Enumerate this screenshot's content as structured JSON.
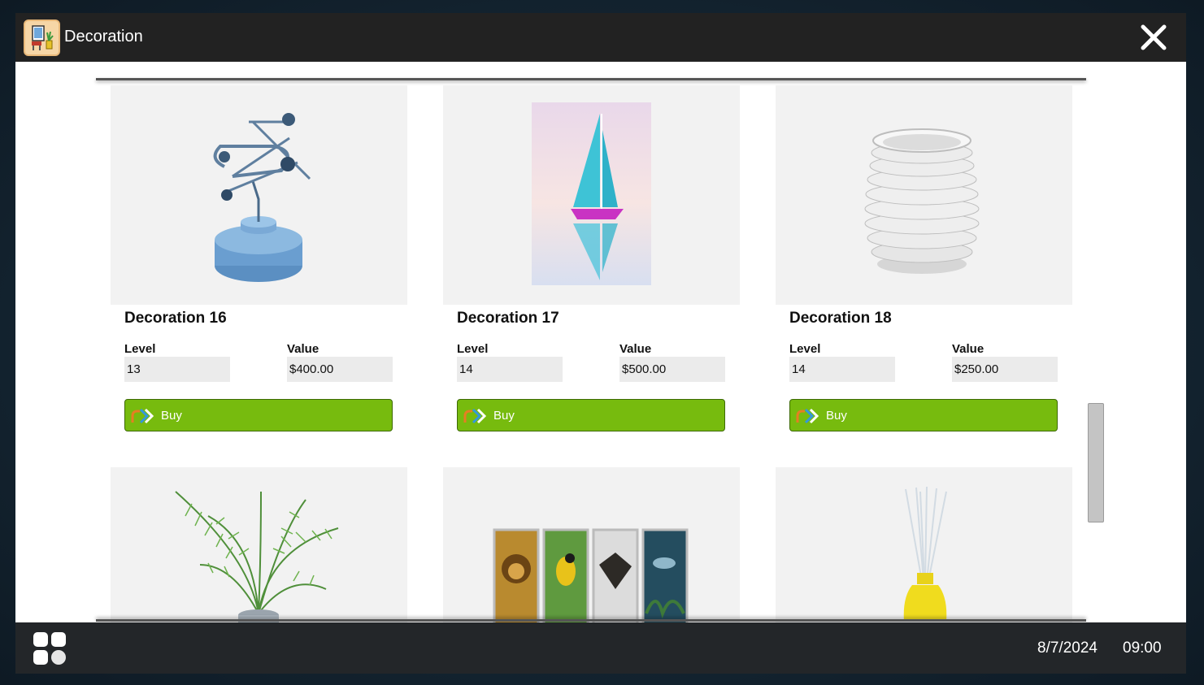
{
  "window": {
    "title": "Decoration",
    "app_icon": "decoration-app-icon",
    "close_icon": "close-icon"
  },
  "colors": {
    "titlebar": "#222222",
    "buy_button": "#77bb0e",
    "taskbar": "#232629",
    "card_bg": "#f2f2f2",
    "field_bg": "#ebebeb"
  },
  "labels": {
    "level": "Level",
    "value": "Value",
    "buy": "Buy"
  },
  "items": [
    {
      "name": "Decoration 16",
      "level": "13",
      "value": "$400.00",
      "image": "kinetic-sculpture"
    },
    {
      "name": "Decoration 17",
      "level": "14",
      "value": "$500.00",
      "image": "sailboat-painting"
    },
    {
      "name": "Decoration 18",
      "level": "14",
      "value": "$250.00",
      "image": "ribbed-vase"
    },
    {
      "image": "potted-palm"
    },
    {
      "image": "animal-panels"
    },
    {
      "image": "reed-diffuser"
    }
  ],
  "taskbar": {
    "apps_icon": "apps-grid-icon",
    "date": "8/7/2024",
    "time": "09:00"
  }
}
